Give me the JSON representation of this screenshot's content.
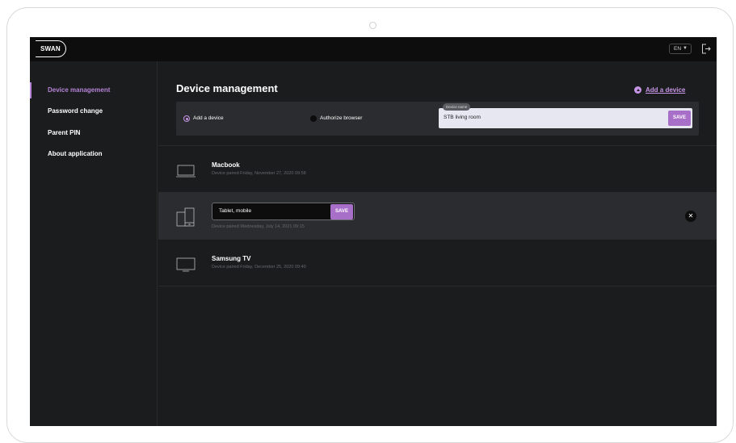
{
  "header": {
    "logo_text": "SWAN",
    "language": "EN"
  },
  "sidebar": {
    "items": [
      {
        "label": "Device management",
        "active": true
      },
      {
        "label": "Password change",
        "active": false
      },
      {
        "label": "Parent PIN",
        "active": false
      },
      {
        "label": "About application",
        "active": false
      }
    ]
  },
  "main": {
    "title": "Device management",
    "add_link": "Add a device",
    "add_panel": {
      "option_add": "Add a device",
      "option_authorize": "Authorize browser",
      "field_label": "Device name",
      "field_value": "STB living room",
      "save_label": "SAVE"
    },
    "devices": [
      {
        "name": "Macbook",
        "paired": "Device paired Friday, November 27, 2020 09:58",
        "icon": "laptop-icon"
      },
      {
        "name": "Tablet, mobile",
        "paired": "Device paired Wednesday, July 14, 2021 09:15",
        "icon": "tablet-mobile-icon",
        "editing": true,
        "save_label": "SAVE"
      },
      {
        "name": "Samsung TV",
        "paired": "Device paired Friday, December 25, 2020 09:40",
        "icon": "tv-icon"
      }
    ]
  },
  "colors": {
    "accent": "#b684d6",
    "background": "#1b1c1e",
    "panel": "#2b2c2f"
  }
}
